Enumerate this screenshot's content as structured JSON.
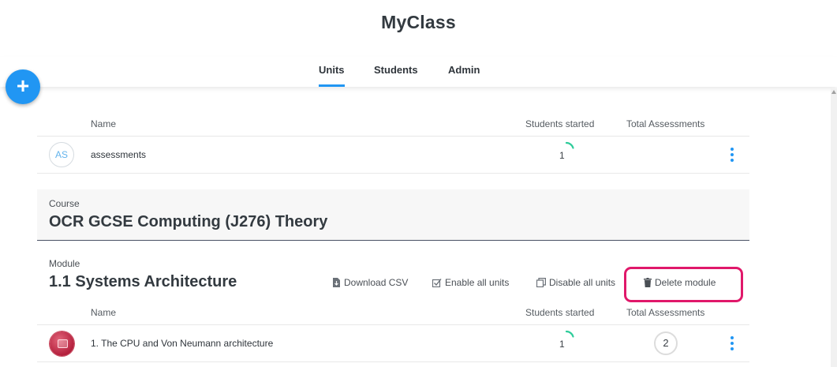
{
  "app": {
    "title": "MyClass"
  },
  "tabs": [
    {
      "label": "Units",
      "active": true
    },
    {
      "label": "Students",
      "active": false
    },
    {
      "label": "Admin",
      "active": false
    }
  ],
  "fab": {
    "label": "+",
    "icon": "plus-icon"
  },
  "top_table": {
    "headers": {
      "name": "Name",
      "students_started": "Students started",
      "total_assessments": "Total Assessments"
    },
    "rows": [
      {
        "avatar": "AS",
        "name": "assessments",
        "students_started": "1"
      }
    ]
  },
  "course": {
    "label": "Course",
    "title": "OCR GCSE Computing (J276) Theory"
  },
  "module": {
    "label": "Module",
    "title": "1.1 Systems Architecture",
    "actions": {
      "download_csv": "Download CSV",
      "enable_all": "Enable all units",
      "disable_all": "Disable all units",
      "delete_module": "Delete module"
    },
    "headers": {
      "name": "Name",
      "students_started": "Students started",
      "total_assessments": "Total Assessments"
    },
    "rows": [
      {
        "name": "1. The CPU and Von Neumann architecture",
        "students_started": "1",
        "total_assessments": "2"
      }
    ]
  },
  "colors": {
    "accent": "#2196f3",
    "highlight": "#e0186a",
    "progress": "#2ecc9a"
  }
}
